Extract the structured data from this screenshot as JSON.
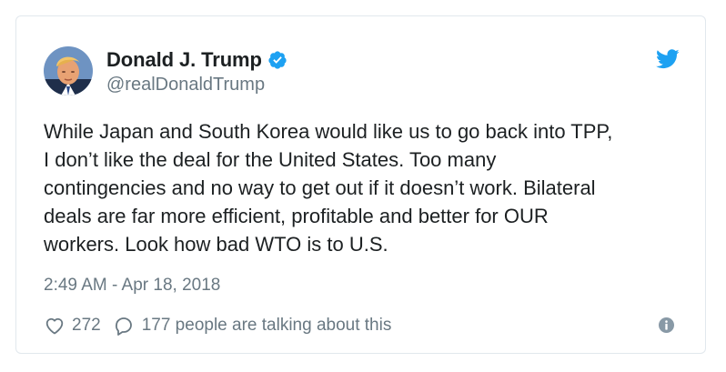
{
  "author": {
    "display_name": "Donald J. Trump",
    "screen_name": "@realDonaldTrump",
    "verified": true
  },
  "tweet": {
    "text": "While Japan and South Korea would like us to go back into TPP,\nI don’t like the deal for the United States. Too many\ncontingencies and no way to get out if it doesn’t work. Bilateral\ndeals are far more efficient, profitable and better for OUR\nworkers. Look how bad WTO is to U.S.",
    "timestamp": "2:49 AM - Apr 18, 2018"
  },
  "actions": {
    "like_count": "272",
    "talking_text": "177 people are talking about this"
  },
  "icons": {
    "brand": "twitter-bird-icon",
    "verified": "verified-badge-icon",
    "like": "heart-icon",
    "reply": "reply-bubble-icon",
    "info": "info-icon"
  },
  "colors": {
    "brand_blue": "#1da1f2",
    "text": "#1c2022",
    "muted": "#697882",
    "border": "#e1e8ed"
  }
}
